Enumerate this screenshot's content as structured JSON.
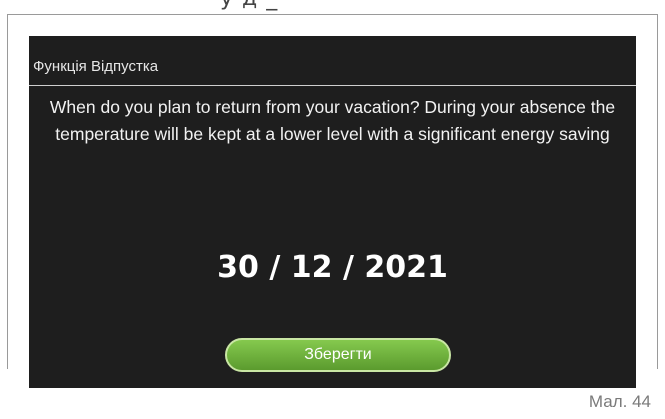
{
  "doc": {
    "clipped_heading": "у д _",
    "figure_caption": "Мал. 44"
  },
  "screen": {
    "title": "Функція Відпустка",
    "message": "When do you plan to return from your vacation? During your absence the temperature will be kept at a lower level with a significant energy saving",
    "date": "30 / 12 / 2021",
    "save_label": "Зберегти"
  },
  "colors": {
    "screen_bg": "#1e1e1e",
    "button_green": "#6fb23e",
    "button_border": "#c9e6a4"
  }
}
